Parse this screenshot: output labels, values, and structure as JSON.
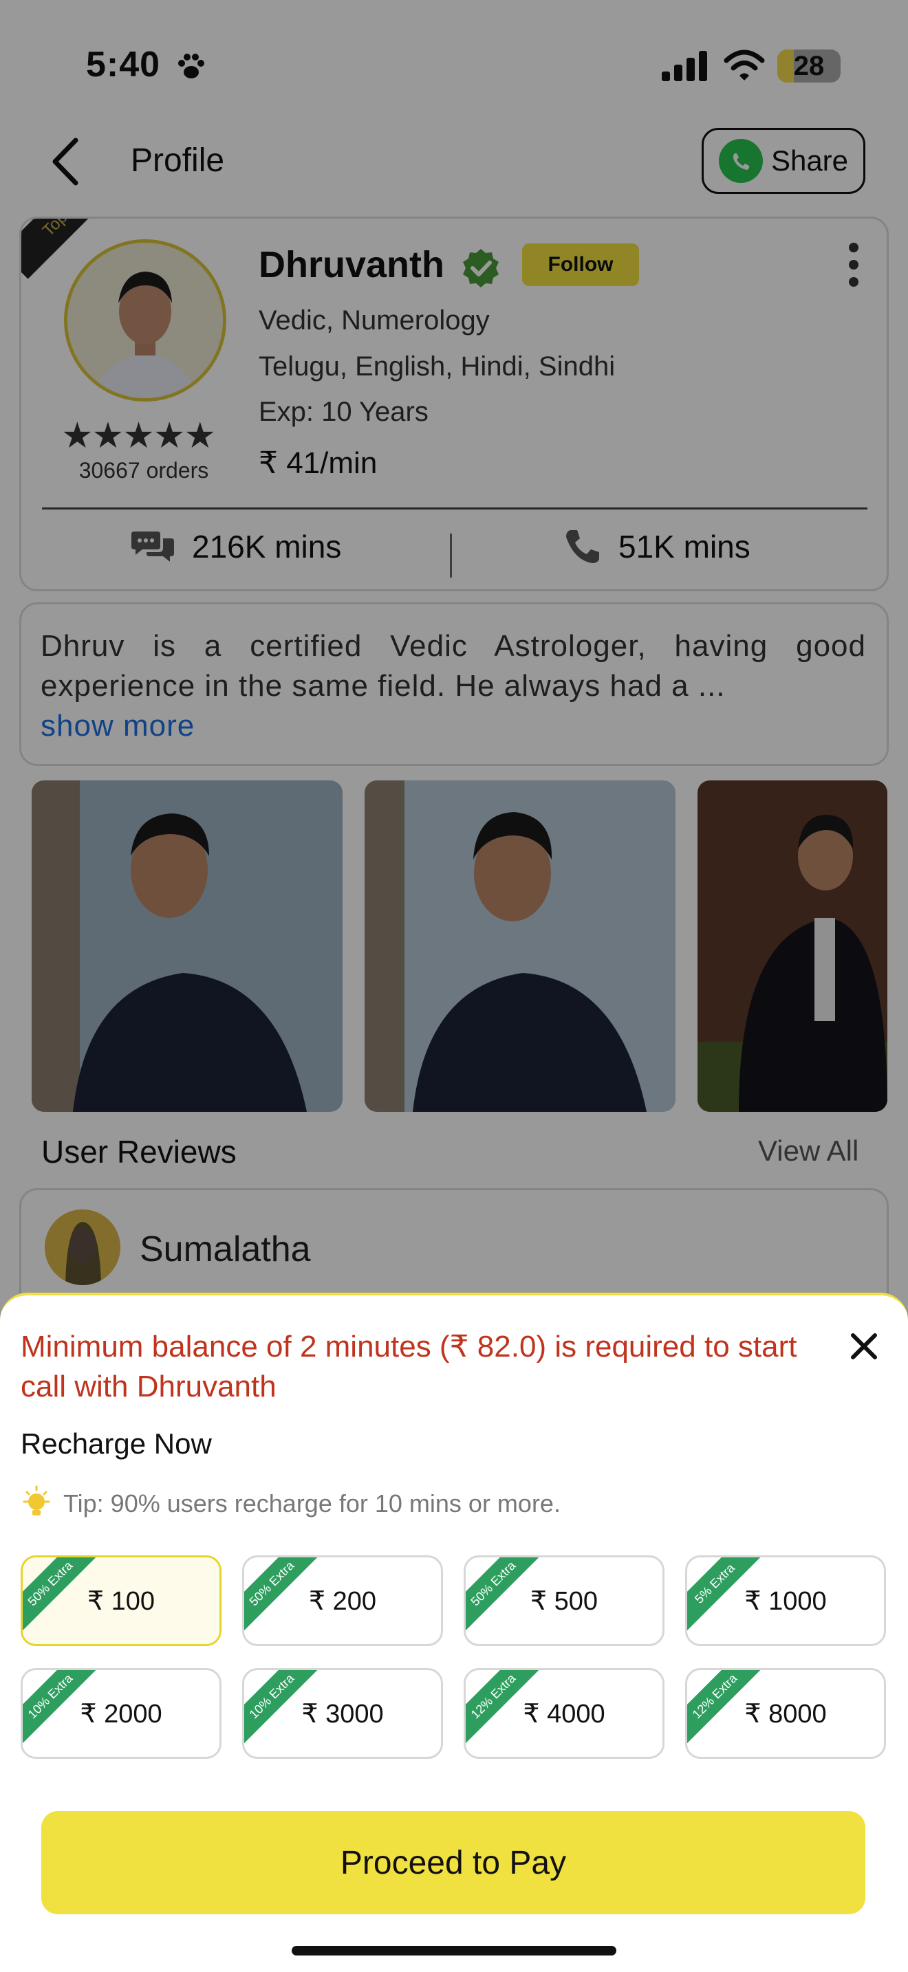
{
  "status_bar": {
    "time": "5:40",
    "battery": "28"
  },
  "header": {
    "title": "Profile",
    "share_label": "Share"
  },
  "profile": {
    "badge": "Top Choice",
    "name": "Dhruvanth",
    "follow_label": "Follow",
    "skills": "Vedic, Numerology",
    "languages": "Telugu, English, Hindi, Sindhi",
    "experience": "Exp: 10 Years",
    "price": "₹ 41/min",
    "rating_stars": "★★★★★",
    "orders": "30667 orders",
    "chat_minutes": "216K mins",
    "call_minutes": "51K mins"
  },
  "about": {
    "text": "Dhruv is a certified Vedic Astrologer, having good experience in the same field. He always had a ...",
    "show_more": "show more"
  },
  "reviews": {
    "title": "User Reviews",
    "view_all": "View All",
    "first_reviewer": "Sumalatha"
  },
  "recharge_sheet": {
    "warning": "Minimum balance of 2 minutes (₹  82.0) is required to start call with Dhruvanth",
    "title": "Recharge Now",
    "tip": "Tip: 90% users recharge for 10 mins or more.",
    "options": [
      {
        "amount": "₹ 100",
        "tag": "50% Extra",
        "selected": true
      },
      {
        "amount": "₹ 200",
        "tag": "50% Extra"
      },
      {
        "amount": "₹ 500",
        "tag": "50% Extra"
      },
      {
        "amount": "₹ 1000",
        "tag": "5% Extra"
      },
      {
        "amount": "₹ 2000",
        "tag": "10% Extra"
      },
      {
        "amount": "₹ 3000",
        "tag": "10% Extra"
      },
      {
        "amount": "₹ 4000",
        "tag": "12% Extra"
      },
      {
        "amount": "₹ 8000",
        "tag": "12% Extra"
      }
    ],
    "proceed_label": "Proceed to Pay"
  },
  "colors": {
    "accent": "#f0e040",
    "warning": "#c0341d",
    "tag_green": "#2e9e5f",
    "link": "#1f6fe0"
  }
}
